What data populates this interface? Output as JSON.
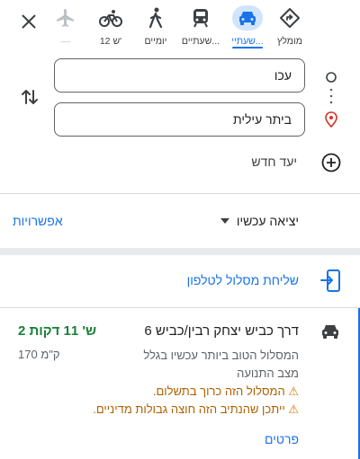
{
  "modes": [
    {
      "id": "recommended",
      "label": "מומלץ",
      "icon": "diamond-turn-icon"
    },
    {
      "id": "car",
      "label": "שעתיי...",
      "icon": "car-icon",
      "selected": true
    },
    {
      "id": "transit",
      "label": "שעתיים...",
      "icon": "train-icon"
    },
    {
      "id": "walk",
      "label": "יומיים",
      "icon": "walk-icon"
    },
    {
      "id": "bike",
      "label": "12 ש'",
      "icon": "bike-icon"
    },
    {
      "id": "flight",
      "label": "—",
      "icon": "plane-icon",
      "disabled": true
    }
  ],
  "origin": {
    "value": "עכו"
  },
  "destination": {
    "value": "ביתר עילית"
  },
  "add_destination_label": "יעד חדש",
  "depart": {
    "label": "יציאה עכשיו"
  },
  "options_label": "אפשרויות",
  "send_to_phone_label": "שליחת מסלול לטלפון",
  "route": {
    "title": "דרך כביש יצחק רבין/כביש 6",
    "duration": "2 ש' 11 דקות",
    "distance": "170 ק\"מ",
    "description": "המסלול הטוב ביותר עכשיו בגלל מצב התנועה",
    "warnings": [
      "המסלול הזה כרוך בתשלום.",
      "ייתכן שהנתיב הזה חוצה גבולות מדיניים."
    ],
    "details_label": "פרטים"
  },
  "colors": {
    "accent": "#1a73e8",
    "duration": "#188038",
    "warning": "#b06000",
    "selected_bg": "#d2e3fc"
  }
}
